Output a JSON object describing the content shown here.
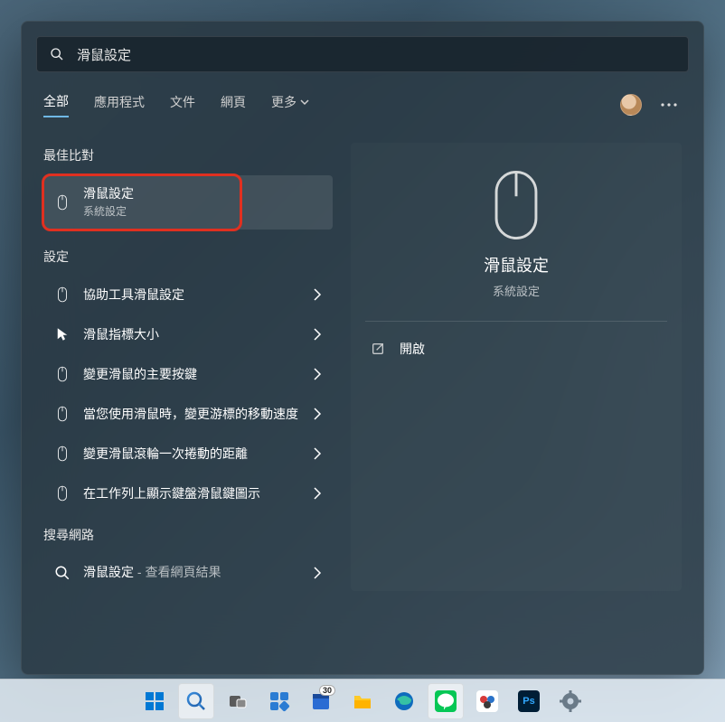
{
  "search": {
    "query": "滑鼠設定"
  },
  "tabs": {
    "all": "全部",
    "apps": "應用程式",
    "docs": "文件",
    "web": "網頁",
    "more": "更多"
  },
  "sections": {
    "best_match": "最佳比對",
    "settings": "設定",
    "search_web": "搜尋網路"
  },
  "best_match": {
    "title": "滑鼠設定",
    "subtitle": "系統設定",
    "icon": "mouse-icon"
  },
  "settings_results": [
    {
      "icon": "mouse-icon",
      "title": "協助工具滑鼠設定"
    },
    {
      "icon": "cursor-icon",
      "title": "滑鼠指標大小"
    },
    {
      "icon": "mouse-icon",
      "title": "變更滑鼠的主要按鍵"
    },
    {
      "icon": "mouse-icon",
      "title": "當您使用滑鼠時，變更游標的移動速度"
    },
    {
      "icon": "mouse-icon",
      "title": "變更滑鼠滾輪一次捲動的距離"
    },
    {
      "icon": "mouse-icon",
      "title": "在工作列上顯示鍵盤滑鼠鍵圖示"
    }
  ],
  "web_result": {
    "icon": "search-icon",
    "title": "滑鼠設定",
    "suffix": " - 查看網頁結果"
  },
  "detail": {
    "title": "滑鼠設定",
    "subtitle": "系統設定",
    "action_open": "開啟"
  },
  "taskbar": {
    "calendar_badge": "30",
    "items": [
      "start",
      "search",
      "taskview",
      "widgets",
      "calendar",
      "file-explorer",
      "edge",
      "line",
      "app-red",
      "photoshop",
      "settings"
    ]
  }
}
